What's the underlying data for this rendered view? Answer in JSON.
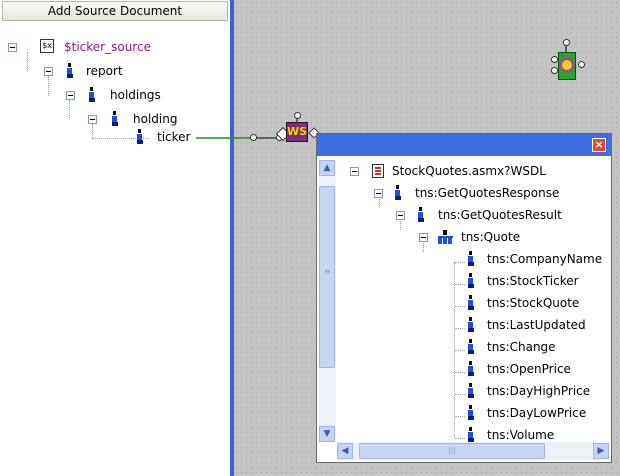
{
  "left_panel": {
    "header": "Add Source Document",
    "tree": [
      {
        "label": "$ticker_source",
        "color": "#8b1c8b"
      },
      {
        "label": "report"
      },
      {
        "label": "holdings"
      },
      {
        "label": "holding"
      },
      {
        "label": "ticker"
      }
    ]
  },
  "canvas": {
    "ws_block_label": "WS",
    "function_block_icon": "gear-icon"
  },
  "popup": {
    "close_label": "×",
    "root": "StockQuotes.asmx?WSDL",
    "tree": [
      "tns:GetQuotesResponse",
      "tns:GetQuotesResult",
      "tns:Quote",
      "tns:CompanyName",
      "tns:StockTicker",
      "tns:StockQuote",
      "tns:LastUpdated",
      "tns:Change",
      "tns:OpenPrice",
      "tns:DayHighPrice",
      "tns:DayLowPrice",
      "tns:Volume"
    ]
  },
  "colors": {
    "title_bar": "#3e6fe0",
    "divider": "#3b63c9",
    "canvas_bg": "#c3c3c3",
    "link_line": "#2a8a2a",
    "ws_block": "#7a2d76",
    "function_block": "#2aa32a"
  }
}
